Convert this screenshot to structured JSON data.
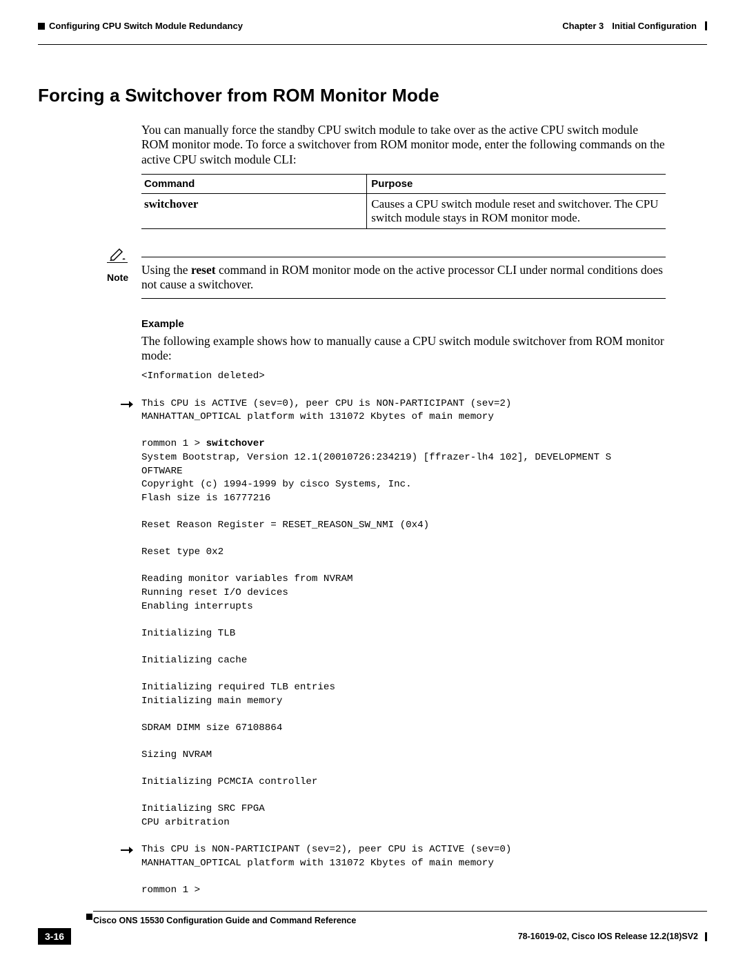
{
  "header": {
    "left_section": "Configuring CPU Switch Module Redundancy",
    "chapter_label": "Chapter 3",
    "chapter_title": "Initial Configuration"
  },
  "title": "Forcing a Switchover from ROM Monitor Mode",
  "intro": "You can manually force the standby CPU switch module to take over as the active CPU switch module ROM monitor mode. To force a switchover from ROM monitor mode, enter the following commands on the active CPU switch module CLI:",
  "table": {
    "headers": {
      "command": "Command",
      "purpose": "Purpose"
    },
    "row": {
      "command": "switchover",
      "purpose": "Causes a CPU switch module reset and switchover. The CPU switch module stays in ROM monitor mode."
    }
  },
  "note": {
    "label": "Note",
    "pre": "Using the ",
    "bold": "reset",
    "post": " command in ROM monitor mode on the active processor CLI under normal conditions does not cause a switchover."
  },
  "example": {
    "heading": "Example",
    "intro": "The following example shows how to manually cause a CPU switch module switchover from ROM monitor mode:",
    "code_top": "<Information deleted>\n",
    "arrow1": "This CPU is ACTIVE (sev=0), peer CPU is NON-PARTICIPANT (sev=2)\nMANHATTAN_OPTICAL platform with 131072 Kbytes of main memory\n",
    "code_mid_pre": "\nrommon 1 > ",
    "code_mid_bold": "switchover",
    "code_mid_post": "\nSystem Bootstrap, Version 12.1(20010726:234219) [ffrazer-lh4 102], DEVELOPMENT S\nOFTWARE\nCopyright (c) 1994-1999 by cisco Systems, Inc.\nFlash size is 16777216\n\nReset Reason Register = RESET_REASON_SW_NMI (0x4)\n\nReset type 0x2\n\nReading monitor variables from NVRAM\nRunning reset I/O devices\nEnabling interrupts\n\nInitializing TLB\n\nInitializing cache\n\nInitializing required TLB entries\nInitializing main memory\n\nSDRAM DIMM size 67108864\n\nSizing NVRAM\n\nInitializing PCMCIA controller\n\nInitializing SRC FPGA\nCPU arbitration\n",
    "arrow2": "This CPU is NON-PARTICIPANT (sev=2), peer CPU is ACTIVE (sev=0)\nMANHATTAN_OPTICAL platform with 131072 Kbytes of main memory\n",
    "code_tail": "\nrommon 1 >"
  },
  "footer": {
    "book_title": "Cisco ONS 15530 Configuration Guide and Command Reference",
    "doc_release": "78-16019-02, Cisco IOS Release 12.2(18)SV2",
    "page_number": "3-16"
  }
}
